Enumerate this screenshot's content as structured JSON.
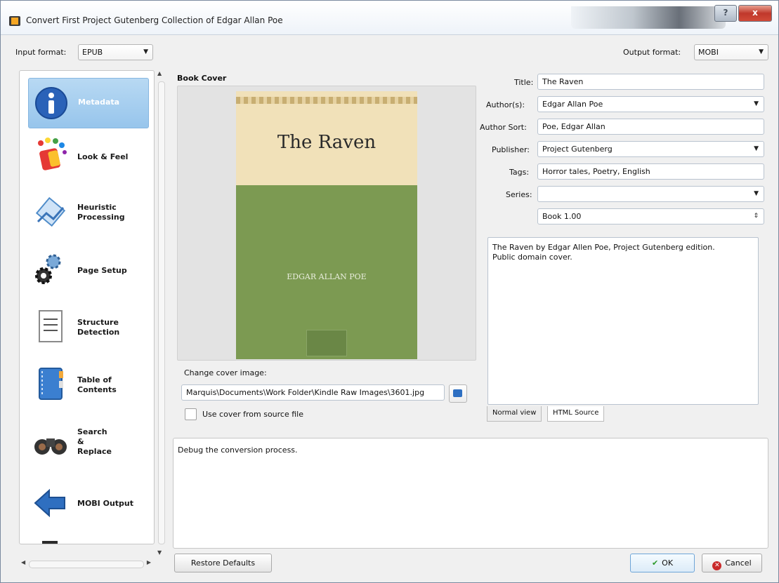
{
  "window": {
    "title": "Convert First Project Gutenberg Collection of Edgar Allan Poe",
    "help": "?",
    "close": "x"
  },
  "input_format": {
    "label": "Input format:",
    "value": "EPUB"
  },
  "output_format": {
    "label": "Output format:",
    "value": "MOBI"
  },
  "sidebar": {
    "items": [
      {
        "label": "Metadata"
      },
      {
        "label": "Look & Feel"
      },
      {
        "label": "Heuristic\nProcessing"
      },
      {
        "label": "Page Setup"
      },
      {
        "label": "Structure\nDetection"
      },
      {
        "label": "Table of\nContents"
      },
      {
        "label": "Search\n&\nReplace"
      },
      {
        "label": "MOBI Output"
      }
    ]
  },
  "book_cover": {
    "heading": "Book Cover",
    "cover_title": "The Raven",
    "cover_author": "EDGAR ALLAN POE",
    "change_label": "Change cover image:",
    "path": "Marquis\\Documents\\Work Folder\\Kindle Raw Images\\3601.jpg",
    "use_cover_label": "Use cover from source file"
  },
  "metadata": {
    "title_label": "Title:",
    "title": "The Raven",
    "authors_label": "Author(s):",
    "authors": "Edgar Allan Poe",
    "author_sort_label": "Author Sort:",
    "author_sort": "Poe, Edgar Allan",
    "publisher_label": "Publisher:",
    "publisher": "Project Gutenberg",
    "tags_label": "Tags:",
    "tags": "Horror tales, Poetry, English",
    "series_label": "Series:",
    "series": "",
    "book_number": "Book 1.00"
  },
  "comments": {
    "text": "The Raven by Edgar Allen Poe, Project Gutenberg edition.\nPublic domain cover.",
    "tab_normal": "Normal view",
    "tab_html": "HTML Source"
  },
  "debug_text": "Debug the conversion process.",
  "buttons": {
    "restore": "Restore Defaults",
    "ok": "OK",
    "cancel": "Cancel"
  },
  "colors": {
    "active_item": "#97c5ec",
    "cover_top": "#f1e1b9",
    "cover_bottom": "#7c9a52"
  }
}
